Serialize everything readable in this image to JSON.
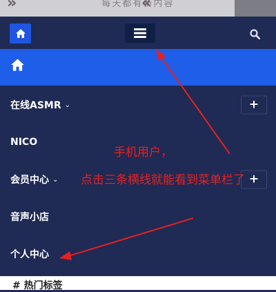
{
  "banner": {
    "text": "每天都有新内容",
    "chev_left": "»",
    "chev_right": "«"
  },
  "header": {
    "home_icon": "home-icon",
    "menu_icon": "hamburger-menu-icon",
    "search_icon": "search-icon"
  },
  "nav": {
    "home_icon": "home-icon",
    "items": [
      {
        "label": "在线ASMR",
        "caret": "⌄",
        "plus": "+"
      },
      {
        "label": "NICO"
      },
      {
        "label": "会员中心",
        "caret": "⌄",
        "plus": "+"
      },
      {
        "label": "音声小店"
      },
      {
        "label": "个人中心"
      }
    ]
  },
  "annotation": {
    "line1": "手机用户，",
    "line2": "点击三条横线就能看到菜单栏了",
    "color": "#e82020"
  },
  "bottom": {
    "label": "# 热门标签"
  },
  "colors": {
    "bg": "#1f2a55",
    "active": "#1e5ee8",
    "home_btn": "#1f55e0",
    "menu_btn": "#0f1f45"
  }
}
